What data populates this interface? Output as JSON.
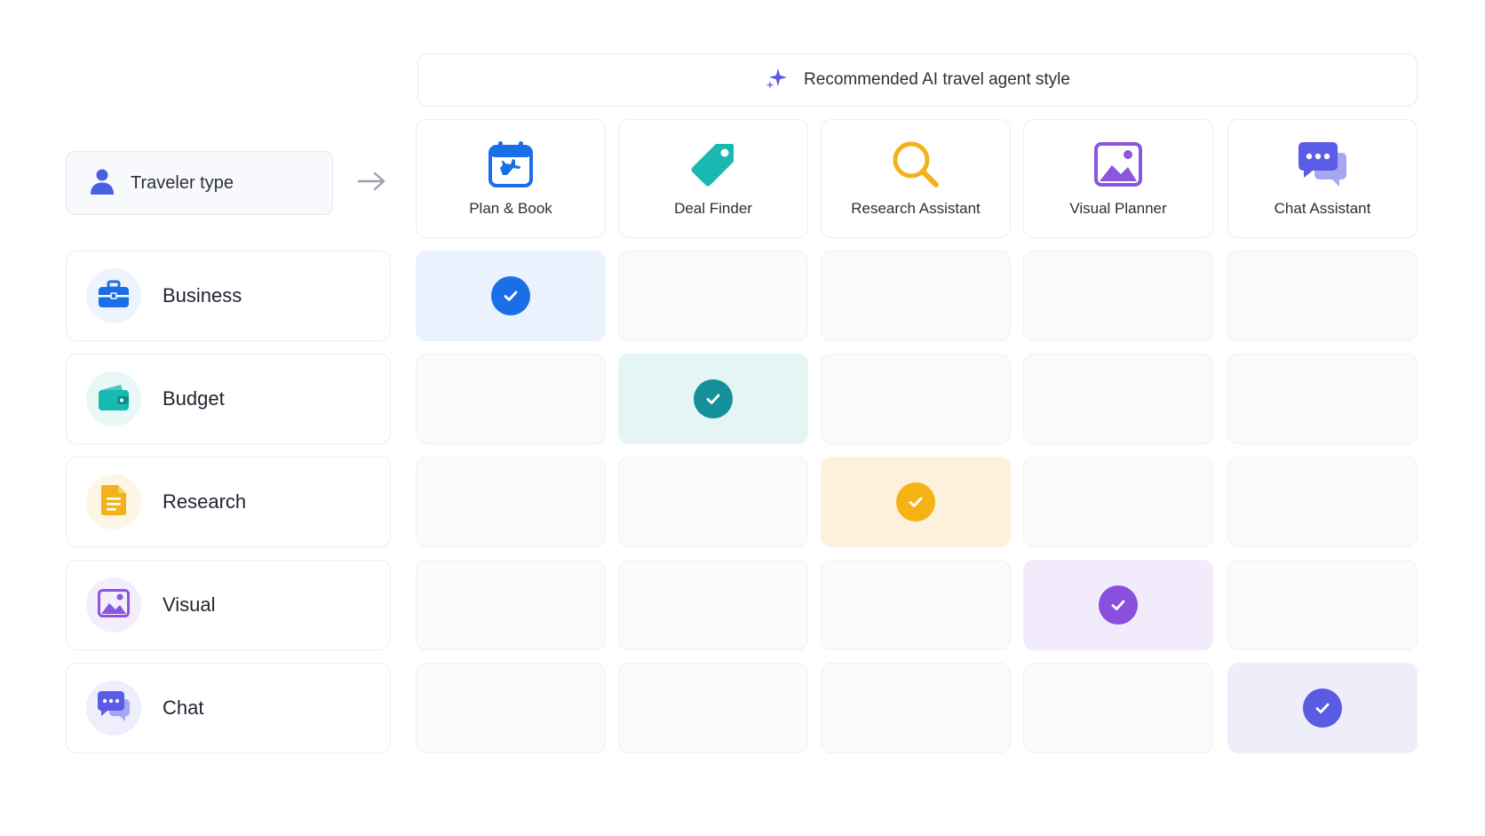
{
  "banner": {
    "title": "Recommended AI travel agent style",
    "icon": "sparkle-icon"
  },
  "traveler": {
    "label": "Traveler type",
    "icon": "person-icon"
  },
  "columns": [
    {
      "label": "Plan & Book",
      "icon": "calendar-plane-icon",
      "color": "#1a6fe8"
    },
    {
      "label": "Deal Finder",
      "icon": "price-tag-icon",
      "color": "#19b8b0"
    },
    {
      "label": "Research Assistant",
      "icon": "magnifier-icon",
      "color": "#f3b11a"
    },
    {
      "label": "Visual Planner",
      "icon": "image-icon",
      "color": "#8b55e0"
    },
    {
      "label": "Chat Assistant",
      "icon": "chat-bubbles-icon",
      "color": "#5b5ce6"
    }
  ],
  "rows": [
    {
      "label": "Business",
      "icon": "briefcase-icon",
      "color": "#1a6fe8",
      "bg": "#eef4fd",
      "match": 0,
      "cellBg": "#eaf2fd",
      "checkColor": "#1a6fe8"
    },
    {
      "label": "Budget",
      "icon": "wallet-icon",
      "color": "#19b8b0",
      "bg": "#e8f8f6",
      "match": 1,
      "cellBg": "#e5f5f3",
      "checkColor": "#14909a"
    },
    {
      "label": "Research",
      "icon": "document-icon",
      "color": "#f3b11a",
      "bg": "#fef6e4",
      "match": 2,
      "cellBg": "#fdf1de",
      "checkColor": "#f5b214"
    },
    {
      "label": "Visual",
      "icon": "image-icon",
      "color": "#8b55e0",
      "bg": "#f3eefc",
      "match": 3,
      "cellBg": "#f1ebfb",
      "checkColor": "#8a4fdd"
    },
    {
      "label": "Chat",
      "icon": "chat-bubbles-icon",
      "color": "#5b5ce6",
      "bg": "#eeeefc",
      "match": 4,
      "cellBg": "#eeeefb",
      "checkColor": "#5a5ae3"
    }
  ]
}
